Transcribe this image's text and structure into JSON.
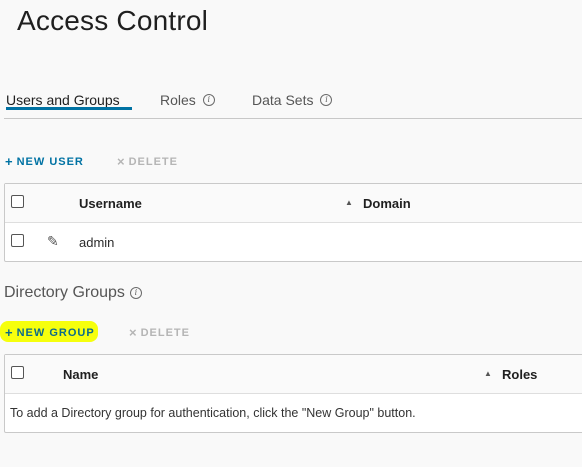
{
  "page": {
    "title": "Access Control"
  },
  "tabs": [
    {
      "label": "Users and Groups",
      "active": true,
      "info": false
    },
    {
      "label": "Roles",
      "active": false,
      "info": true
    },
    {
      "label": "Data Sets",
      "active": false,
      "info": true
    }
  ],
  "users": {
    "new_label": "NEW USER",
    "delete_label": "DELETE",
    "columns": {
      "username": "Username",
      "domain": "Domain"
    },
    "rows": [
      {
        "username": "admin",
        "domain": ""
      }
    ]
  },
  "groups": {
    "title": "Directory Groups",
    "new_label": "NEW GROUP",
    "delete_label": "DELETE",
    "columns": {
      "name": "Name",
      "roles": "Roles"
    },
    "empty_message": "To add a Directory group for authentication, click the \"New Group\" button."
  },
  "icons": {
    "add": "plus-icon",
    "delete": "x-icon",
    "info": "info-icon",
    "edit": "pencil-icon",
    "sort": "sort-ascending-icon"
  },
  "colors": {
    "accent": "#0072a3",
    "highlight": "#f5ff00",
    "disabled": "#b5b5b5"
  }
}
